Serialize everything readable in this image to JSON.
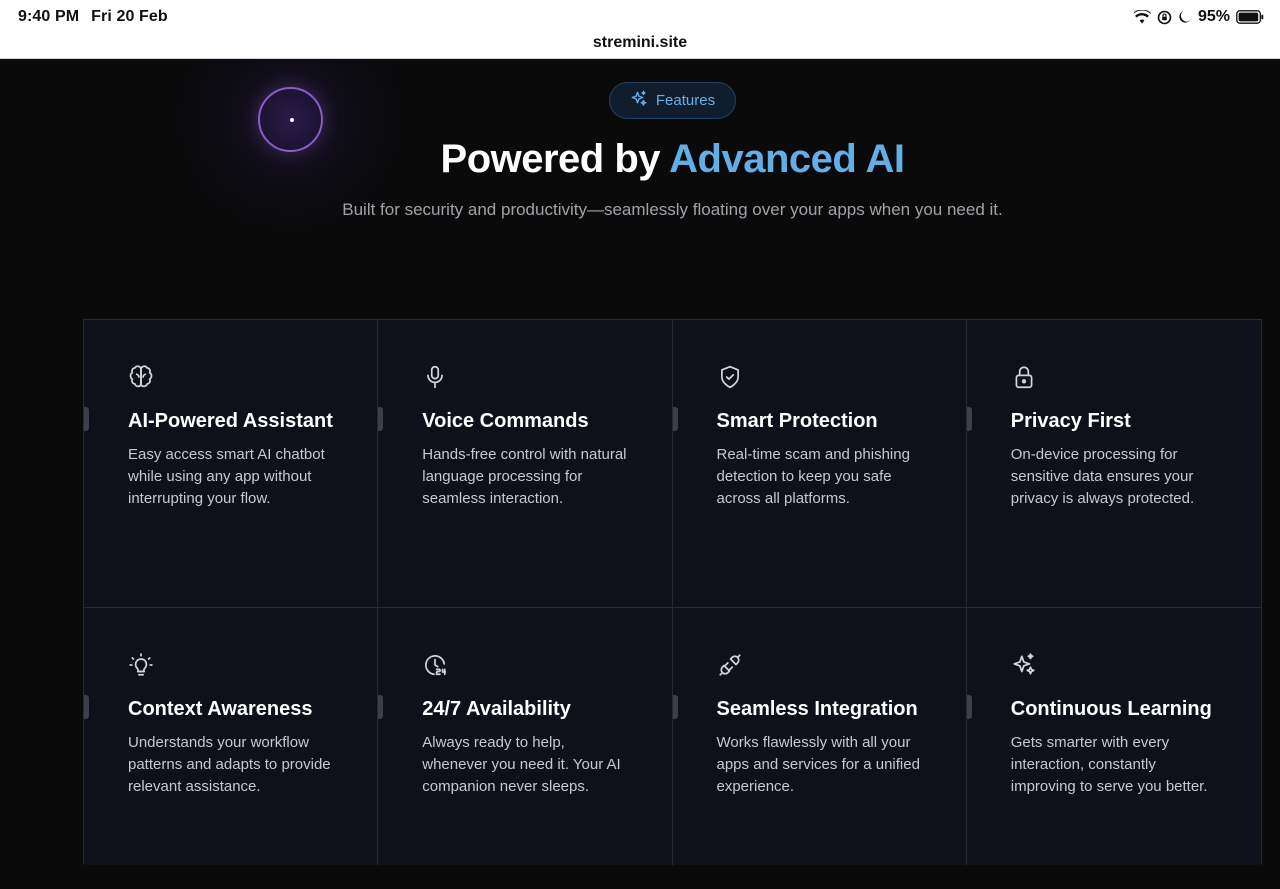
{
  "status_bar": {
    "time": "9:40 PM",
    "date": "Fri 20 Feb",
    "battery": "95%"
  },
  "browser": {
    "url": "stremini.site"
  },
  "hero": {
    "badge_label": "Features",
    "headline_prefix": "Powered by ",
    "headline_accent": "Advanced AI",
    "subtitle": "Built for security and productivity—seamlessly floating over your apps when you need it."
  },
  "colors": {
    "accent": "#63aee6",
    "card_bg": "#0e111a",
    "page_bg": "#0a0a0b",
    "orb_border": "#8b5cc9"
  },
  "features": [
    {
      "icon": "brain-icon",
      "title": "AI-Powered Assistant",
      "description": "Easy access smart AI chatbot while using any app without interrupting your flow."
    },
    {
      "icon": "microphone-icon",
      "title": "Voice Commands",
      "description": "Hands-free control with natural language processing for seamless interaction."
    },
    {
      "icon": "shield-check-icon",
      "title": "Smart Protection",
      "description": "Real-time scam and phishing detection to keep you safe across all platforms."
    },
    {
      "icon": "lock-icon",
      "title": "Privacy First",
      "description": "On-device processing for sensitive data ensures your privacy is always protected."
    },
    {
      "icon": "lightbulb-icon",
      "title": "Context Awareness",
      "description": "Understands your workflow patterns and adapts to provide relevant assistance."
    },
    {
      "icon": "clock-24-icon",
      "title": "24/7 Availability",
      "description": "Always ready to help, whenever you need it. Your AI companion never sleeps."
    },
    {
      "icon": "plug-icon",
      "title": "Seamless Integration",
      "description": "Works flawlessly with all your apps and services for a unified experience."
    },
    {
      "icon": "sparkles-icon",
      "title": "Continuous Learning",
      "description": "Gets smarter with every interaction, constantly improving to serve you better."
    }
  ]
}
